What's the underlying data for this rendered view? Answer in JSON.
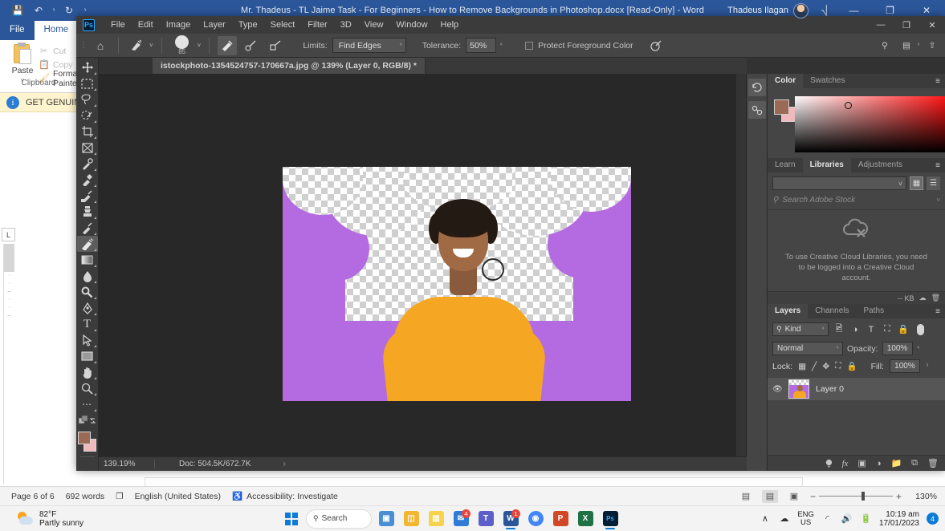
{
  "word": {
    "title": "Mr. Thadeus -  TL Jaime Task - For Beginners - How to Remove Backgrounds in Photoshop.docx [Read-Only]  -  Word",
    "user_name": "Thadeus Ilagan",
    "quick_access": [
      {
        "name": "save-icon",
        "glyph": "💾"
      },
      {
        "name": "undo-icon",
        "glyph": "↶"
      },
      {
        "name": "undo-dropdown-caret-icon",
        "glyph": "˅"
      },
      {
        "name": "redo-icon",
        "glyph": "↻"
      },
      {
        "name": "customize-qat-caret-icon",
        "glyph": "˅"
      }
    ],
    "tabs": [
      {
        "label": "File",
        "active": false
      },
      {
        "label": "Home",
        "active": true
      }
    ],
    "ribbon": {
      "paste_label": "Paste",
      "paste_caret": "˅",
      "cut_label": "Cut",
      "copy_label": "Copy",
      "format_painter_label": "Format Painter",
      "group_label": "Clipboard"
    },
    "notice": {
      "text": "GET GENUINE OFFICE",
      "info_glyph": "i",
      "collapse_glyph": "∧",
      "close_glyph": "✕"
    },
    "ruler_corner_label": "L",
    "window_buttons": [
      {
        "name": "ribbon-display-options-button",
        "glyph": "⌸"
      },
      {
        "name": "minimize-button",
        "glyph": "—"
      },
      {
        "name": "restore-button",
        "glyph": "❐"
      },
      {
        "name": "close-button",
        "glyph": "✕"
      }
    ],
    "status": {
      "page": "Page 6 of 6",
      "words": "692 words",
      "proofing_glyph": "❐",
      "language": "English (United States)",
      "accessibility": "Accessibility: Investigate",
      "zoom_percent": "130%",
      "zoom_minus": "−",
      "zoom_plus": "+",
      "views": [
        {
          "name": "read-mode-view-button",
          "glyph": "▤",
          "active": false
        },
        {
          "name": "print-layout-view-button",
          "glyph": "▤",
          "active": true
        },
        {
          "name": "web-layout-view-button",
          "glyph": "▣",
          "active": false
        }
      ]
    }
  },
  "photoshop": {
    "app_logo": "Ps",
    "menus": [
      "File",
      "Edit",
      "Image",
      "Layer",
      "Type",
      "Select",
      "Filter",
      "3D",
      "View",
      "Window",
      "Help"
    ],
    "window_buttons": [
      {
        "name": "minimize-button",
        "glyph": "—"
      },
      {
        "name": "restore-button",
        "glyph": "❐"
      },
      {
        "name": "close-button",
        "glyph": "✕"
      }
    ],
    "options_bar": {
      "home_icon": "⌂",
      "tool_preset_caret": "˅",
      "brush_size": "85",
      "sampling_buttons": [
        {
          "name": "sampling-continuous-button",
          "active": true
        },
        {
          "name": "sampling-once-button",
          "active": false
        },
        {
          "name": "sampling-background-swatch-button",
          "active": false
        }
      ],
      "limits_label": "Limits:",
      "limits_value": "Find Edges",
      "tolerance_label": "Tolerance:",
      "tolerance_value": "50%",
      "protect_foreground_label": "Protect Foreground Color",
      "pressure_icon_name": "tablet-pressure-icon",
      "right_icons": [
        {
          "name": "search-icon",
          "glyph": "⚲"
        },
        {
          "name": "workspace-icon",
          "glyph": "▤"
        },
        {
          "name": "share-icon",
          "glyph": "⇧"
        }
      ]
    },
    "document_tab": "istockphoto-1354524757-170667a.jpg @ 139% (Layer 0, RGB/8) *",
    "tools": [
      {
        "name": "move-tool",
        "label": "Move Tool",
        "active": false
      },
      {
        "name": "rectangular-marquee-tool",
        "label": "Rectangular Marquee Tool",
        "active": false
      },
      {
        "name": "lasso-tool",
        "label": "Lasso Tool",
        "active": false
      },
      {
        "name": "object-selection-tool",
        "label": "Object Selection Tool",
        "active": false
      },
      {
        "name": "crop-tool",
        "label": "Crop Tool",
        "active": false
      },
      {
        "name": "frame-tool",
        "label": "Frame Tool",
        "active": false
      },
      {
        "name": "eyedropper-tool",
        "label": "Eyedropper Tool",
        "active": false
      },
      {
        "name": "spot-healing-brush-tool",
        "label": "Spot Healing Brush Tool",
        "active": false
      },
      {
        "name": "brush-tool",
        "label": "Brush Tool",
        "active": false
      },
      {
        "name": "clone-stamp-tool",
        "label": "Clone Stamp Tool",
        "active": false
      },
      {
        "name": "history-brush-tool",
        "label": "History Brush Tool",
        "active": false
      },
      {
        "name": "background-eraser-tool",
        "label": "Background Eraser Tool",
        "active": true
      },
      {
        "name": "gradient-tool",
        "label": "Gradient Tool",
        "active": false
      },
      {
        "name": "blur-tool",
        "label": "Blur Tool",
        "active": false
      },
      {
        "name": "dodge-tool",
        "label": "Dodge Tool",
        "active": false
      },
      {
        "name": "pen-tool",
        "label": "Pen Tool",
        "active": false
      },
      {
        "name": "horizontal-type-tool",
        "label": "Horizontal Type Tool",
        "active": false
      },
      {
        "name": "path-selection-tool",
        "label": "Path Selection Tool",
        "active": false
      },
      {
        "name": "rectangle-tool",
        "label": "Rectangle Tool",
        "active": false
      },
      {
        "name": "hand-tool",
        "label": "Hand Tool",
        "active": false
      },
      {
        "name": "zoom-tool",
        "label": "Zoom Tool",
        "active": false
      },
      {
        "name": "edit-toolbar-button",
        "label": "Edit Toolbar",
        "active": false
      }
    ],
    "colors": {
      "foreground": "#9b6a55",
      "background": "#f0b9bd",
      "canvas_purple": "#b46ae0",
      "sweater_yellow": "#f5a623"
    },
    "status_bar": {
      "zoom": "139.19%",
      "doc": "Doc: 504.5K/672.7K",
      "caret": "›"
    },
    "dock_rail": [
      {
        "name": "history-panel-rail-button",
        "glyph": "↺"
      },
      {
        "name": "actions-panel-rail-button",
        "glyph": "▶"
      }
    ],
    "color_panel": {
      "tabs": [
        {
          "label": "Color",
          "active": true
        },
        {
          "label": "Swatches",
          "active": false
        }
      ],
      "menu_glyph": "≡"
    },
    "libraries_panel": {
      "tabs": [
        {
          "label": "Learn",
          "active": false
        },
        {
          "label": "Libraries",
          "active": true
        },
        {
          "label": "Adjustments",
          "active": false
        }
      ],
      "menu_glyph": "≡",
      "library_select_value": "",
      "select_caret": "˅",
      "search_placeholder": "Search Adobe Stock",
      "search_icon": "⚲",
      "search_caret": "˅",
      "empty_message": "To use Creative Cloud Libraries, you need to be logged into a Creative Cloud account.",
      "footer_size": "-- KB",
      "footer_sync_icon": "cloud-sync-icon",
      "footer_delete_icon": "trash-icon",
      "view_buttons": [
        {
          "name": "grid-view-button",
          "glyph": "▦",
          "active": true
        },
        {
          "name": "list-view-button",
          "glyph": "☰",
          "active": false
        }
      ]
    },
    "layers_panel": {
      "tabs": [
        {
          "label": "Layers",
          "active": true
        },
        {
          "label": "Channels",
          "active": false
        },
        {
          "label": "Paths",
          "active": false
        }
      ],
      "menu_glyph": "≡",
      "filter_kind": "Kind",
      "filter_search_icon": "⚲",
      "filter_icons": [
        {
          "name": "filter-pixel-layers-icon",
          "glyph": "ὛB"
        },
        {
          "name": "filter-adjustment-layers-icon",
          "glyph": "◑"
        },
        {
          "name": "filter-type-layers-icon",
          "glyph": "T"
        },
        {
          "name": "filter-shape-layers-icon",
          "glyph": "⛶"
        },
        {
          "name": "filter-smart-objects-icon",
          "glyph": "ὑ2"
        }
      ],
      "blend_mode": "Normal",
      "opacity_label": "Opacity:",
      "opacity_value": "100%",
      "lock_label": "Lock:",
      "lock_icons": [
        {
          "name": "lock-transparent-pixels-icon",
          "glyph": "▦"
        },
        {
          "name": "lock-image-pixels-icon",
          "glyph": "╱"
        },
        {
          "name": "lock-position-icon",
          "glyph": "✥"
        },
        {
          "name": "lock-artboard-nesting-icon",
          "glyph": "⛶"
        },
        {
          "name": "lock-all-icon",
          "glyph": "ὑ2"
        }
      ],
      "fill_label": "Fill:",
      "fill_value": "100%",
      "caret": "˅",
      "layers": [
        {
          "name": "Layer 0",
          "visible": true,
          "selected": true
        }
      ],
      "footer_buttons": [
        {
          "name": "link-layers-button",
          "glyph": "⚭"
        },
        {
          "name": "layer-style-fx-button",
          "glyph": "fx"
        },
        {
          "name": "add-layer-mask-button",
          "glyph": "▣"
        },
        {
          "name": "new-fill-adjustment-layer-button",
          "glyph": "◑"
        },
        {
          "name": "new-group-button",
          "glyph": "Ὄ1"
        },
        {
          "name": "new-layer-button",
          "glyph": "⧉"
        },
        {
          "name": "delete-layer-button",
          "glyph": "Ὕ1"
        }
      ]
    }
  },
  "taskbar": {
    "weather_temp": "82°F",
    "weather_desc": "Partly sunny",
    "search_label": "Search",
    "search_icon": "⚲",
    "start_name": "start-button",
    "apps": [
      {
        "name": "taskview-button",
        "glyph": "▣",
        "color": "#4a8fd4",
        "badge": "",
        "running": false
      },
      {
        "name": "file-explorer-button",
        "glyph": "▤",
        "color": "#f2b632",
        "badge": "",
        "running": false
      },
      {
        "name": "sticky-notes-button",
        "glyph": "▤",
        "color": "#f5d34c",
        "badge": "",
        "running": false
      },
      {
        "name": "mail-button",
        "glyph": "✉",
        "color": "#2e7cd6",
        "badge": "",
        "running": false
      },
      {
        "name": "teams-button",
        "glyph": "T",
        "color": "#5b5fc7",
        "badge": "",
        "running": false
      },
      {
        "name": "word-button",
        "glyph": "W",
        "color": "#2b579a",
        "badge": "1",
        "running": true
      },
      {
        "name": "chrome-button",
        "glyph": "◉",
        "color": "#4285f4",
        "badge": "",
        "running": false
      },
      {
        "name": "powerpoint-button",
        "glyph": "P",
        "color": "#d24726",
        "badge": "",
        "running": false
      },
      {
        "name": "excel-button",
        "glyph": "X",
        "color": "#207245",
        "badge": "",
        "running": false
      },
      {
        "name": "photoshop-button",
        "glyph": "Ps",
        "color": "#001e36",
        "badge": "",
        "running": true
      }
    ],
    "tray": {
      "chevron": "∧",
      "onedrive_icon": "cloud-sync-icon",
      "language_line1": "ENG",
      "language_line2": "US",
      "wifi_icon": "wifi-icon",
      "volume_icon": "speaker-icon",
      "battery_icon": "battery-icon",
      "time": "10:19 am",
      "date": "17/01/2023",
      "notification_count": "4"
    }
  }
}
